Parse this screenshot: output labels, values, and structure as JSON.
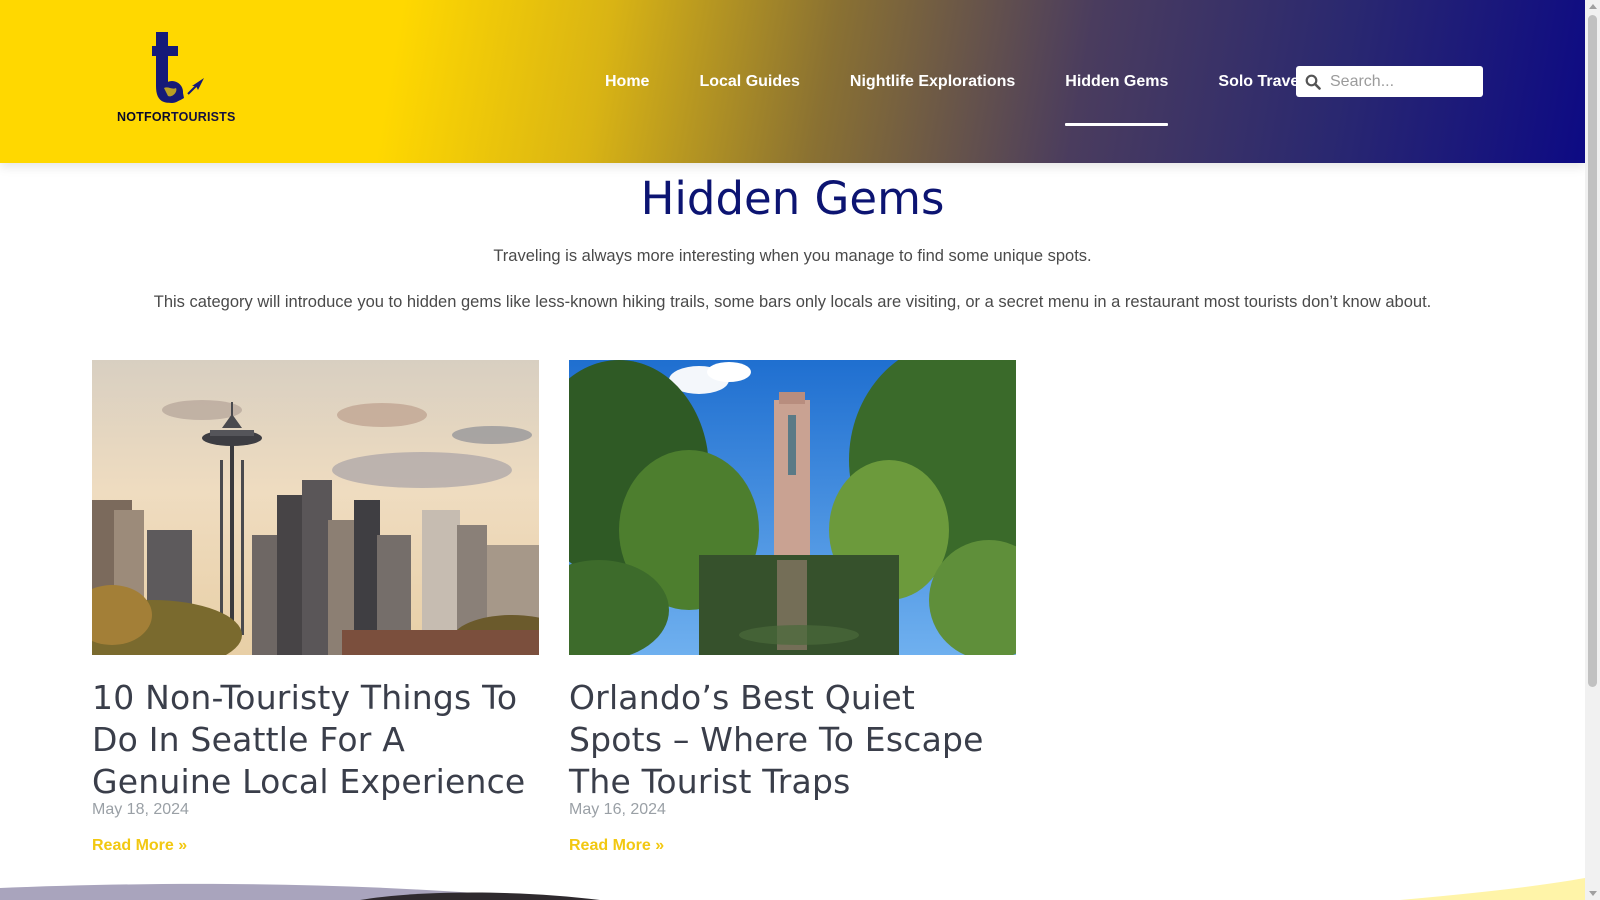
{
  "brand": {
    "logo_text_a": "NOTFOR",
    "logo_text_b": "TOURISTS"
  },
  "nav": {
    "items": [
      {
        "label": "Home"
      },
      {
        "label": "Local Guides"
      },
      {
        "label": "Nightlife Explorations"
      },
      {
        "label": "Hidden Gems",
        "active": true
      },
      {
        "label": "Solo Travel"
      }
    ]
  },
  "search": {
    "placeholder": "Search..."
  },
  "page": {
    "title": "Hidden Gems",
    "intro_1": "Traveling is always more interesting when you manage to find some unique spots.",
    "intro_2": "This category will introduce you to hidden gems like less-known hiking trails, some bars only locals are visiting, or a secret menu in a restaurant most tourists don’t know about."
  },
  "posts": [
    {
      "title": "10 Non-Touristy Things To Do In Seattle For A Genuine Local Experience",
      "date": "May 18, 2024",
      "read_more": "Read More »"
    },
    {
      "title": "Orlando’s Best Quiet Spots – Where To Escape The Tourist Traps",
      "date": "May 16, 2024",
      "read_more": "Read More »"
    }
  ],
  "colors": {
    "accent_yellow": "#ffd800",
    "brand_navy": "#0c1472",
    "read_more": "#f2c811"
  }
}
